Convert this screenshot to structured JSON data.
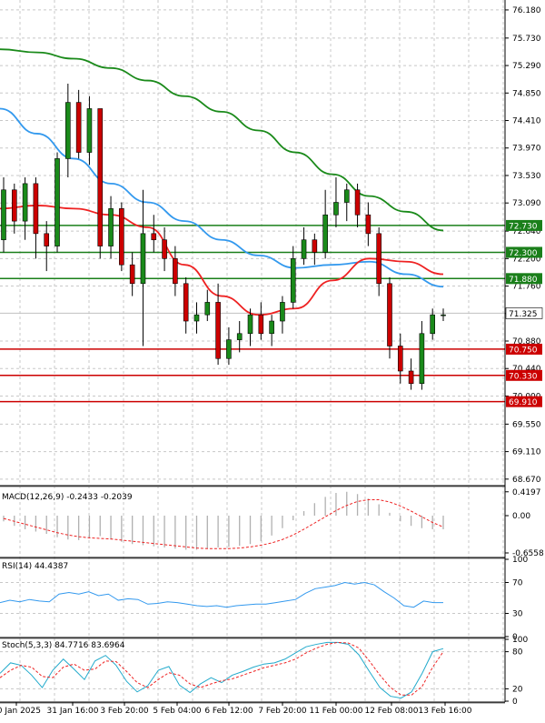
{
  "chart_data": [
    {
      "type": "candlestick",
      "panel": "price",
      "y_ticks": [
        "76.180",
        "75.730",
        "75.290",
        "74.850",
        "74.410",
        "73.970",
        "73.530",
        "73.090",
        "72.640",
        "72.200",
        "71.760",
        "71.325",
        "70.880",
        "70.440",
        "70.000",
        "69.550",
        "69.110",
        "68.670"
      ],
      "y_tick_values": [
        76.18,
        75.73,
        75.29,
        74.85,
        74.41,
        73.97,
        73.53,
        73.09,
        72.64,
        72.2,
        71.76,
        71.32,
        70.88,
        70.44,
        70.0,
        69.55,
        69.11,
        68.67
      ],
      "ylim": [
        68.58,
        76.31
      ],
      "x_ticks": [
        "30 Jan 2025",
        "31 Jan 16:00",
        "3 Feb 20:00",
        "5 Feb 04:00",
        "6 Feb 12:00",
        "7 Feb 20:00",
        "11 Feb 00:00",
        "12 Feb 08:00",
        "13 Feb 16:00"
      ],
      "current_price": "71.325",
      "resistance_levels": [
        "72.730",
        "72.300",
        "71.880"
      ],
      "support_levels": [
        "70.750",
        "70.330",
        "69.910"
      ],
      "resistance_values": [
        72.73,
        72.3,
        71.88
      ],
      "support_values": [
        70.75,
        70.33,
        69.91
      ],
      "series": [
        {
          "name": "MA green",
          "values": [
            75.55,
            75.5,
            75.4,
            75.25,
            75.05,
            74.8,
            74.55,
            74.25,
            73.9,
            73.55,
            73.2,
            72.95,
            72.65
          ]
        },
        {
          "name": "MA blue",
          "values": [
            74.6,
            74.2,
            73.8,
            73.4,
            73.1,
            72.8,
            72.5,
            72.25,
            72.05,
            72.1,
            72.15,
            71.95,
            71.75
          ]
        },
        {
          "name": "MA red",
          "values": [
            73.0,
            73.05,
            73.0,
            72.9,
            72.7,
            72.1,
            71.6,
            71.3,
            71.4,
            71.85,
            72.2,
            72.15,
            71.95
          ]
        }
      ],
      "candles": [
        [
          72.5,
          73.3,
          73.5,
          72.3
        ],
        [
          73.3,
          72.8,
          73.4,
          72.6
        ],
        [
          72.8,
          73.4,
          73.5,
          72.5
        ],
        [
          73.4,
          72.6,
          73.5,
          72.2
        ],
        [
          72.6,
          72.4,
          72.8,
          72.0
        ],
        [
          72.4,
          73.8,
          73.9,
          72.3
        ],
        [
          73.8,
          74.7,
          75.0,
          73.5
        ],
        [
          74.7,
          73.9,
          74.9,
          73.8
        ],
        [
          73.9,
          74.6,
          74.8,
          73.7
        ],
        [
          74.6,
          72.4,
          74.6,
          72.2
        ],
        [
          72.4,
          73.0,
          73.2,
          72.2
        ],
        [
          73.0,
          72.1,
          73.1,
          72.0
        ],
        [
          72.1,
          71.8,
          72.3,
          71.6
        ],
        [
          71.8,
          72.6,
          73.3,
          70.8
        ],
        [
          72.6,
          72.5,
          72.9,
          72.3
        ],
        [
          72.5,
          72.2,
          72.7,
          72.0
        ],
        [
          72.2,
          71.8,
          72.4,
          71.6
        ],
        [
          71.8,
          71.2,
          71.9,
          71.0
        ],
        [
          71.2,
          71.3,
          71.5,
          71.0
        ],
        [
          71.3,
          71.5,
          71.7,
          71.2
        ],
        [
          71.5,
          70.6,
          71.8,
          70.5
        ],
        [
          70.6,
          70.9,
          71.1,
          70.5
        ],
        [
          70.9,
          71.0,
          71.2,
          70.7
        ],
        [
          71.0,
          71.3,
          71.4,
          70.8
        ],
        [
          71.3,
          71.0,
          71.5,
          70.9
        ],
        [
          71.0,
          71.2,
          71.3,
          70.8
        ],
        [
          71.2,
          71.5,
          71.6,
          71.0
        ],
        [
          71.5,
          72.2,
          72.4,
          71.4
        ],
        [
          72.2,
          72.5,
          72.7,
          72.1
        ],
        [
          72.5,
          72.3,
          72.6,
          72.1
        ],
        [
          72.3,
          72.9,
          73.3,
          72.2
        ],
        [
          72.9,
          73.1,
          73.5,
          72.7
        ],
        [
          73.1,
          73.3,
          73.4,
          72.8
        ],
        [
          73.3,
          72.9,
          73.4,
          72.7
        ],
        [
          72.9,
          72.6,
          73.1,
          72.4
        ],
        [
          72.6,
          71.8,
          72.7,
          71.6
        ],
        [
          71.8,
          70.8,
          71.9,
          70.6
        ],
        [
          70.8,
          70.4,
          71.0,
          70.2
        ],
        [
          70.4,
          70.2,
          70.6,
          70.1
        ],
        [
          70.2,
          71.0,
          71.2,
          70.1
        ],
        [
          71.0,
          71.3,
          71.4,
          70.9
        ],
        [
          71.3,
          71.3,
          71.4,
          71.2
        ]
      ]
    },
    {
      "type": "histogram",
      "panel": "macd",
      "label": "MACD(12,26,9) -0.2433 -0.2039",
      "y_ticks": [
        "0.4197",
        "0.00",
        "-0.6558"
      ],
      "y_tick_values": [
        0.4197,
        0.0,
        -0.6558
      ],
      "ylim": [
        -0.72,
        0.48
      ],
      "histogram": [
        -0.1,
        -0.18,
        -0.24,
        -0.28,
        -0.32,
        -0.38,
        -0.42,
        -0.43,
        -0.4,
        -0.36,
        -0.42,
        -0.46,
        -0.5,
        -0.52,
        -0.54,
        -0.56,
        -0.58,
        -0.6,
        -0.6,
        -0.58,
        -0.56,
        -0.55,
        -0.53,
        -0.5,
        -0.45,
        -0.35,
        -0.22,
        -0.08,
        0.08,
        0.22,
        0.33,
        0.4,
        0.42,
        0.38,
        0.3,
        0.2,
        0.05,
        -0.1,
        -0.18,
        -0.22,
        -0.24,
        -0.24
      ],
      "signal": [
        -0.05,
        -0.1,
        -0.15,
        -0.2,
        -0.25,
        -0.3,
        -0.34,
        -0.37,
        -0.39,
        -0.4,
        -0.41,
        -0.43,
        -0.45,
        -0.47,
        -0.49,
        -0.51,
        -0.53,
        -0.55,
        -0.57,
        -0.58,
        -0.58,
        -0.58,
        -0.57,
        -0.55,
        -0.52,
        -0.48,
        -0.42,
        -0.34,
        -0.24,
        -0.13,
        -0.02,
        0.09,
        0.18,
        0.25,
        0.28,
        0.28,
        0.24,
        0.17,
        0.08,
        -0.02,
        -0.12,
        -0.2
      ]
    },
    {
      "type": "line",
      "panel": "rsi",
      "label": "RSI(14) 44.4387",
      "y_ticks": [
        "100",
        "70",
        "30",
        "0"
      ],
      "y_tick_values": [
        100,
        70,
        30,
        0
      ],
      "ylim": [
        0,
        100
      ],
      "values": [
        44,
        47,
        45,
        48,
        46,
        45,
        55,
        57,
        55,
        58,
        53,
        55,
        47,
        49,
        48,
        42,
        43,
        45,
        44,
        42,
        40,
        39,
        40,
        38,
        40,
        41,
        42,
        42,
        44,
        46,
        48,
        56,
        62,
        64,
        66,
        70,
        68,
        70,
        67,
        58,
        50,
        40,
        38,
        46,
        44,
        44
      ]
    },
    {
      "type": "line",
      "panel": "stoch",
      "label": "Stoch(5,3,3) 84.7716 83.6964",
      "y_ticks": [
        "100",
        "80",
        "20",
        "0"
      ],
      "y_tick_values": [
        100,
        80,
        20,
        0
      ],
      "ylim": [
        0,
        100
      ],
      "series": [
        {
          "values": [
            45,
            62,
            58,
            42,
            22,
            50,
            68,
            52,
            35,
            65,
            74,
            58,
            32,
            15,
            25,
            50,
            56,
            26,
            14,
            28,
            38,
            30,
            42,
            48,
            55,
            60,
            62,
            68,
            78,
            88,
            92,
            95,
            95,
            92,
            75,
            48,
            22,
            8,
            5,
            15,
            45,
            80,
            85
          ]
        },
        {
          "values": [
            38,
            50,
            58,
            55,
            40,
            38,
            55,
            60,
            50,
            52,
            65,
            64,
            48,
            30,
            22,
            35,
            46,
            42,
            28,
            22,
            28,
            33,
            36,
            42,
            48,
            54,
            58,
            62,
            68,
            78,
            86,
            92,
            95,
            94,
            86,
            65,
            42,
            22,
            10,
            10,
            24,
            55,
            80
          ]
        }
      ]
    }
  ]
}
